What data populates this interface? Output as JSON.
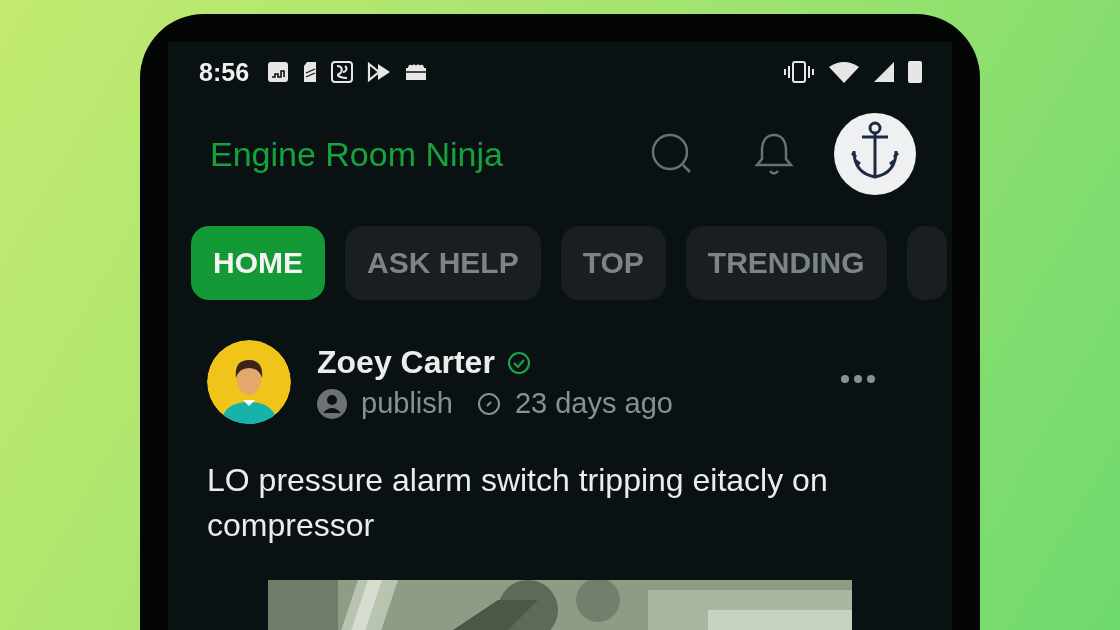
{
  "status_bar": {
    "time": "8:56"
  },
  "app_bar": {
    "title": "Engine Room Ninja"
  },
  "tabs": [
    {
      "label": "HOME",
      "selected": true
    },
    {
      "label": "ASK HELP",
      "selected": false
    },
    {
      "label": "TOP",
      "selected": false
    },
    {
      "label": "TRENDING",
      "selected": false
    }
  ],
  "post": {
    "author": "Zoey Carter",
    "verified": true,
    "status": "publish",
    "time": "23 days ago",
    "title": "LO pressure alarm switch tripping eitacly on compressor"
  }
}
